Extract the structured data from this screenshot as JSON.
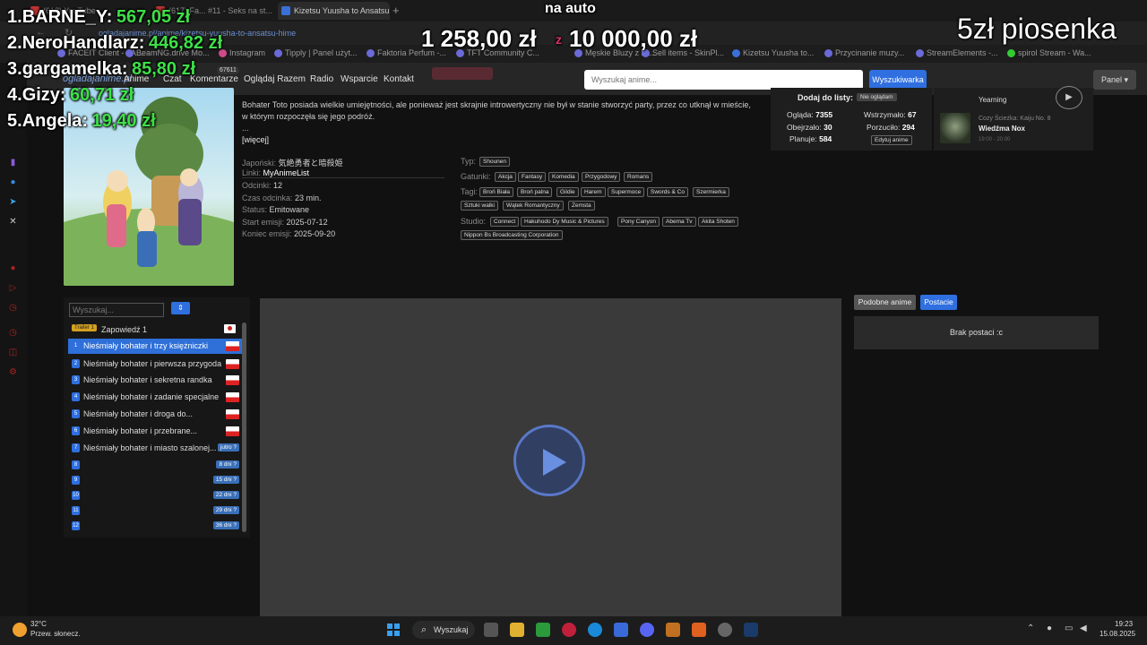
{
  "browser": {
    "tabs": [
      {
        "label": "(618) YouTube"
      },
      {
        "label": "(617) Fa... #11 - Seks na st..."
      },
      {
        "label": "Kizetsu Yuusha to Ansatsu Hime"
      }
    ],
    "url": "ogladajanime.pl/anime/kizetsu-yuusha-to-ansatsu-hime",
    "bookmarks": [
      "FACEIT Client - FA...",
      "BeamNG.drive Mo...",
      "Instagram",
      "Tipply | Panel użyt...",
      "Faktoria Perfum -...",
      "TFT Community C...",
      "Męskie Bluzy z ka...",
      "Sell items - SkinPl...",
      "Kizetsu Yuusha to...",
      "Przycinanie muzy...",
      "StreamElements -...",
      "spirol Stream - Wa..."
    ]
  },
  "site": {
    "logo": "ogladajanime.pl",
    "nav": {
      "anime": "Anime",
      "czat": "Czat",
      "komentarze": "Komentarze",
      "count": "67611",
      "ogladaj_razem": "Oglądaj Razem",
      "radio": "Radio",
      "wsparcie": "Wsparcie",
      "kontakt": "Kontakt"
    },
    "search_placeholder": "Wyszukaj anime...",
    "search_button": "Wyszukiwarka",
    "panel_button": "Panel ▾"
  },
  "anime": {
    "description": "Bohater Toto posiada wielkie umiejętności, ale ponieważ jest skrajnie introwertyczny nie był w stanie stworzyć party, przez co utknął w mieście, w którym rozpoczęła się jego podróż.",
    "dots": "...",
    "more": "[więcej]",
    "info": {
      "japanese_label": "Japoński:",
      "japanese": "気絶勇者と暗殺姫",
      "links_label": "Linki:",
      "links": "MyAnimeList",
      "episodes_label": "Odcinki:",
      "episodes": "12",
      "duration_label": "Czas odcinka:",
      "duration": "23 min.",
      "status_label": "Status:",
      "status": "Emitowane",
      "start_label": "Start emisji:",
      "start": "2025-07-12",
      "end_label": "Koniec emisji:",
      "end": "2025-09-20"
    },
    "type_label": "Typ:",
    "type": "Shounen",
    "genres_label": "Gatunki:",
    "genres": [
      "Akcja",
      "Fantasy",
      "Komedia",
      "Przygodowy",
      "Romans"
    ],
    "tags_label": "Tagi:",
    "tags": [
      "Broń Biała",
      "Broń palna",
      "Gildie",
      "Harem",
      "Supermoce",
      "Swords & Co",
      "Szermierka",
      "Sztuki walki",
      "Wątek Romantyczny",
      "Zemsta"
    ],
    "studio_label": "Studio:",
    "studios": [
      "Connect",
      "Hakuhodo Dy Music & Pictures",
      "Pony Canyon",
      "Abema Tv",
      "Akita Shoten",
      "Nippon Bs Broadcasting Corporation"
    ]
  },
  "list_widget": {
    "title": "Dodaj do listy:",
    "status": "Nie oglądam",
    "watching_label": "Ogląda:",
    "watching": "7355",
    "paused_label": "Wstrzymało:",
    "paused": "67",
    "watched_label": "Obejrzało:",
    "watched": "30",
    "dropped_label": "Porzuciło:",
    "dropped": "294",
    "planned_label": "Planuje:",
    "planned": "584",
    "edit": "Edytuj anime"
  },
  "music_widget": {
    "top": "Yearning",
    "subtitle": "Cozy Ścieżka: Kaiju No. 8",
    "title": "Wiedźma Nox",
    "time": "19:00 - 20:00"
  },
  "episodes": {
    "search_placeholder": "Wyszukaj...",
    "sort_icon": "⇕",
    "trailer_badge": "Trailer 1",
    "trailer_label": "Zapowiedź 1",
    "items": [
      {
        "num": "1",
        "title": "Nieśmiały bohater i trzy księżniczki",
        "badge": ""
      },
      {
        "num": "2",
        "title": "Nieśmiały bohater i pierwsza przygoda",
        "badge": ""
      },
      {
        "num": "3",
        "title": "Nieśmiały bohater i sekretna randka",
        "badge": ""
      },
      {
        "num": "4",
        "title": "Nieśmiały bohater i zadanie specjalne",
        "badge": ""
      },
      {
        "num": "5",
        "title": "Nieśmiały bohater i droga do...",
        "badge": ""
      },
      {
        "num": "6",
        "title": "Nieśmiały bohater i przebrane...",
        "badge": ""
      },
      {
        "num": "7",
        "title": "Nieśmiały bohater i miasto szalonej...",
        "badge": "jutro ?"
      },
      {
        "num": "8",
        "title": "",
        "badge": "8 dni ?"
      },
      {
        "num": "9",
        "title": "",
        "badge": "15 dni ?"
      },
      {
        "num": "10",
        "title": "",
        "badge": "22 dni ?"
      },
      {
        "num": "11",
        "title": "",
        "badge": "29 dni ?"
      },
      {
        "num": "12",
        "title": "",
        "badge": "36 dni ?"
      }
    ]
  },
  "side_tabs": {
    "similar": "Podobne anime",
    "characters": "Postacie",
    "no_characters": "Brak postaci :c"
  },
  "overlay": {
    "leaderboard": [
      {
        "rank": "1.",
        "name": "BARNE_Y:",
        "amount": "567,05 zł",
        "color": "#3de048"
      },
      {
        "rank": "2.",
        "name": "NeroHandlarz:",
        "amount": "446,82 zł",
        "color": "#3de048"
      },
      {
        "rank": "3.",
        "name": "gargamelka:",
        "amount": "85,80 zł",
        "color": "#3de048"
      },
      {
        "rank": "4.",
        "name": "Gizy:",
        "amount": "60,71 zł",
        "color": "#3de048"
      },
      {
        "rank": "5.",
        "name": "Angela:",
        "amount": "19,40 zł",
        "color": "#3de048"
      }
    ],
    "na_auto": "na auto",
    "goal_current": "1 258,00 zł",
    "goal_sep": "z",
    "goal_target": "10 000,00 zł",
    "song": "5zł piosenka"
  },
  "taskbar": {
    "temp": "32°C",
    "weather": "Przew. słonecz.",
    "search": "Wyszukaj",
    "time": "19:23",
    "date": "15.08.2025"
  }
}
